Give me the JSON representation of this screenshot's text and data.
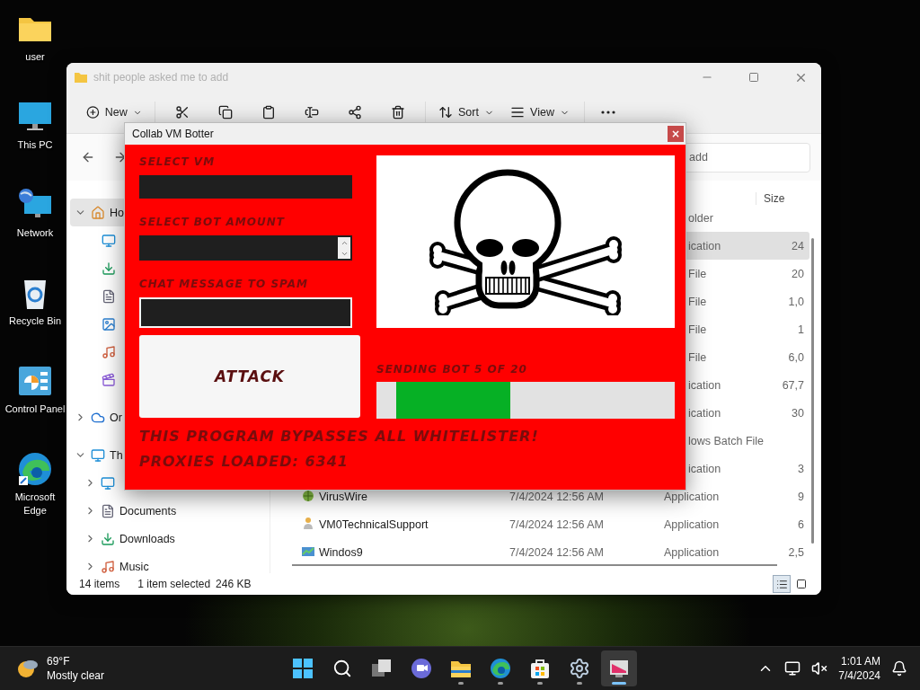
{
  "desktop_icons": [
    {
      "kind": "folder",
      "label": "user"
    },
    {
      "kind": "pc",
      "label": "This PC"
    },
    {
      "kind": "network",
      "label": "Network"
    },
    {
      "kind": "bin",
      "label": "Recycle Bin"
    },
    {
      "kind": "control",
      "label": "Control Panel"
    },
    {
      "kind": "edge",
      "label": "Microsoft Edge"
    }
  ],
  "explorer": {
    "title": "shit people asked me to add",
    "toolbar": {
      "new_label": "New",
      "sort_label": "Sort",
      "view_label": "View"
    },
    "search": {
      "placeholder": "add"
    },
    "sidebar": [
      {
        "kind": "home",
        "label": "Ho",
        "selected": true,
        "expanded": true,
        "children": [
          {
            "kind": "desktop",
            "selected": false
          },
          {
            "kind": "downloads",
            "selected": false
          },
          {
            "kind": "documents",
            "selected": false
          },
          {
            "kind": "pictures",
            "selected": false
          },
          {
            "kind": "music",
            "selected": false
          },
          {
            "kind": "videos",
            "selected": false
          }
        ]
      },
      {
        "kind": "cloud",
        "label": "Or",
        "selected": false,
        "expanded": false
      },
      {
        "kind": "pc",
        "label": "Th",
        "selected": false,
        "expanded": true,
        "children": [
          {
            "kind": "desktop",
            "selected": false,
            "expanded": false
          },
          {
            "kind": "documents",
            "label": "Documents",
            "selected": false,
            "expanded": false
          },
          {
            "kind": "downloads",
            "label": "Downloads",
            "selected": false,
            "expanded": false
          },
          {
            "kind": "music",
            "label": "Music",
            "selected": false,
            "expanded": false
          }
        ]
      }
    ],
    "columns": [
      {
        "label": "Size"
      }
    ],
    "rows": [
      {
        "type": "older",
        "selected": false
      },
      {
        "type": "ication",
        "size": "24",
        "selected": true
      },
      {
        "type": "File",
        "size": "20",
        "selected": false
      },
      {
        "type": "File",
        "size": "1,0",
        "selected": false
      },
      {
        "type": "File",
        "size": "1",
        "selected": false
      },
      {
        "type": "File",
        "size": "6,0",
        "selected": false
      },
      {
        "type": "ication",
        "size": "67,7",
        "selected": false
      },
      {
        "type": "ication",
        "size": "30",
        "selected": false
      },
      {
        "type": "lows Batch File",
        "selected": false
      },
      {
        "type": "ication",
        "size": "3",
        "selected": false
      },
      {
        "kind": "globe",
        "name": "VirusWire",
        "date": "7/4/2024 12:56 AM",
        "type": "Application",
        "size": "9",
        "selected": false
      },
      {
        "kind": "person",
        "name": "VM0TechnicalSupport",
        "date": "7/4/2024 12:56 AM",
        "type": "Application",
        "size": "6",
        "selected": false
      },
      {
        "kind": "chart",
        "name": "Windos9",
        "date": "7/4/2024 12:56 AM",
        "type": "Application",
        "size": "2,5",
        "selected": false
      }
    ],
    "status": {
      "items": "14 items",
      "selection": "1 item selected",
      "size": "246 KB"
    },
    "view_buttons": [
      {
        "kind": "details",
        "selected": true
      },
      {
        "kind": "tiles",
        "selected": false
      }
    ]
  },
  "botter": {
    "title": "Collab VM Botter",
    "close": "×",
    "fields": [
      {
        "kind": "text",
        "label": "SELECT VM",
        "focused": false
      },
      {
        "kind": "spin",
        "label": "SELECT BOT AMOUNT",
        "focused": false
      },
      {
        "kind": "text",
        "label": "CHAT MESSAGE TO SPAM",
        "focused": true
      }
    ],
    "attack_button": "ATTACK",
    "progress": {
      "label": "SENDING BOT 5 OF 20",
      "level": 0.45
    },
    "notes": [
      "THIS PROGRAM BYPASSES ALL WHITELISTER!",
      "PROXIES LOADED: 6341"
    ]
  },
  "taskbar": {
    "weather": {
      "temp": "69°F",
      "condition": "Mostly clear"
    },
    "apps": [
      {
        "kind": "start",
        "running": false,
        "selected": false
      },
      {
        "kind": "search",
        "running": false,
        "selected": false
      },
      {
        "kind": "taskview",
        "running": false,
        "selected": false
      },
      {
        "kind": "chat",
        "running": false,
        "selected": false
      },
      {
        "kind": "explorer",
        "running": true,
        "selected": false
      },
      {
        "kind": "edge",
        "running": true,
        "selected": false
      },
      {
        "kind": "store",
        "running": true,
        "selected": false
      },
      {
        "kind": "settings",
        "running": true,
        "selected": false
      },
      {
        "kind": "botter",
        "running": true,
        "selected": true
      }
    ],
    "time": "1:01 AM",
    "date": "7/4/2024"
  }
}
